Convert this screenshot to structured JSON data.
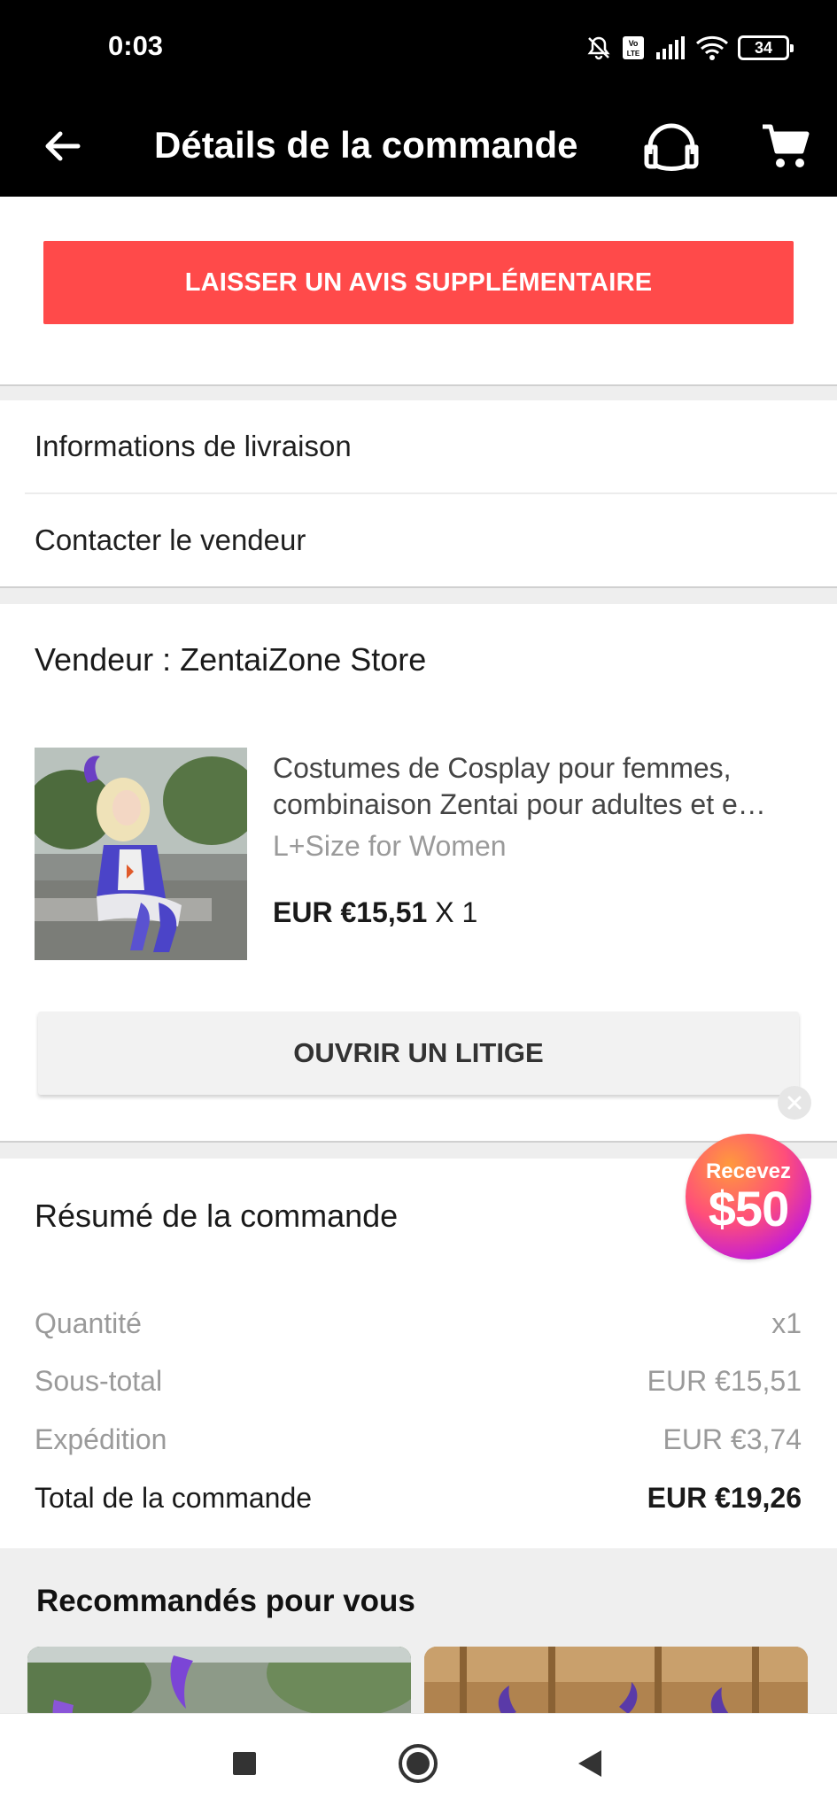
{
  "status_bar": {
    "time": "0:03",
    "battery": "34",
    "icons": [
      "mute-icon",
      "volte-icon",
      "signal-icon",
      "wifi-icon",
      "battery-icon"
    ]
  },
  "app_bar": {
    "title": "Détails de la commande",
    "icons": [
      "back-arrow-icon",
      "headset-icon",
      "cart-icon"
    ]
  },
  "review_button": "LAISSER UN AVIS SUPPLÉMENTAIRE",
  "links": {
    "delivery_info": "Informations de livraison",
    "contact_seller": "Contacter le vendeur"
  },
  "seller": {
    "label": "Vendeur : ZentaiZone Store",
    "product": {
      "title_line1": "Costumes de Cosplay pour femmes,",
      "title_line2": "combinaison Zentai pour adultes et e…",
      "sku": "L+Size for Women",
      "price": "EUR €15,51",
      "quantity": "X 1"
    },
    "dispute_button": "OUVRIR UN LITIGE"
  },
  "promo": {
    "top": "Recevez",
    "amount": "$50"
  },
  "summary": {
    "title": "Résumé de la commande",
    "rows": [
      {
        "label": "Quantité",
        "value": "x1"
      },
      {
        "label": "Sous-total",
        "value": "EUR €15,51"
      },
      {
        "label": "Expédition",
        "value": "EUR €3,74"
      },
      {
        "label": "Total de la commande",
        "value": "EUR €19,26"
      }
    ]
  },
  "recommendations": {
    "title": "Recommandés pour vous"
  },
  "colors": {
    "accent": "#ff4a4a",
    "topbar": "#000000",
    "section_gap": "#eeeeee"
  }
}
